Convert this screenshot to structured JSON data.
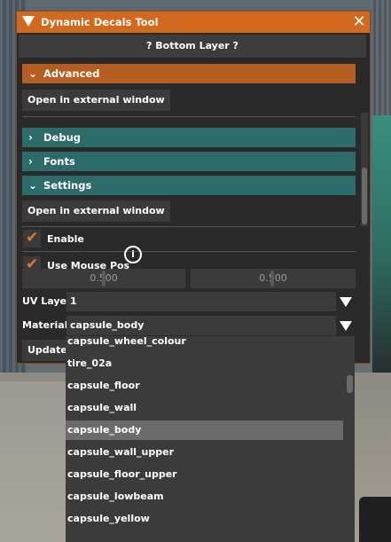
{
  "window": {
    "title": "Dynamic Decals Tool",
    "close_label": "✕",
    "layer_label": "? Bottom Layer ?"
  },
  "sections": {
    "advanced": {
      "label": "Advanced",
      "expanded": true,
      "color": "#b65e22"
    },
    "open_external_1": "Open in external window",
    "debug": {
      "label": "Debug",
      "expanded": false,
      "color": "#2d6b6a"
    },
    "fonts": {
      "label": "Fonts",
      "expanded": false,
      "color": "#2d6b6a"
    },
    "settings": {
      "label": "Settings",
      "expanded": true,
      "color": "#2d6b6a"
    },
    "open_external_2": "Open in external window"
  },
  "settings": {
    "enable": {
      "label": "Enable",
      "checked": true
    },
    "use_mouse_pos": {
      "label": "Use Mouse Pos",
      "checked": true
    },
    "info_icon": "i",
    "slider_x": {
      "value": "0.500"
    },
    "slider_y": {
      "value": "0.500"
    },
    "uv_layer": {
      "label": "UV Layer",
      "value": "1"
    },
    "material": {
      "label": "Material",
      "value": "capsule_body"
    },
    "update_button": "Update m"
  },
  "material_dropdown": {
    "options": [
      "capsule_wheel_colour",
      "tire_02a",
      "capsule_floor",
      "capsule_wall",
      "capsule_body",
      "capsule_wall_upper",
      "capsule_floor_upper",
      "capsule_lowbeam",
      "capsule_yellow"
    ],
    "selected": "capsule_body"
  },
  "colors": {
    "accent": "#d2691e",
    "teal": "#2d6b6a",
    "check": "#e07a22"
  }
}
